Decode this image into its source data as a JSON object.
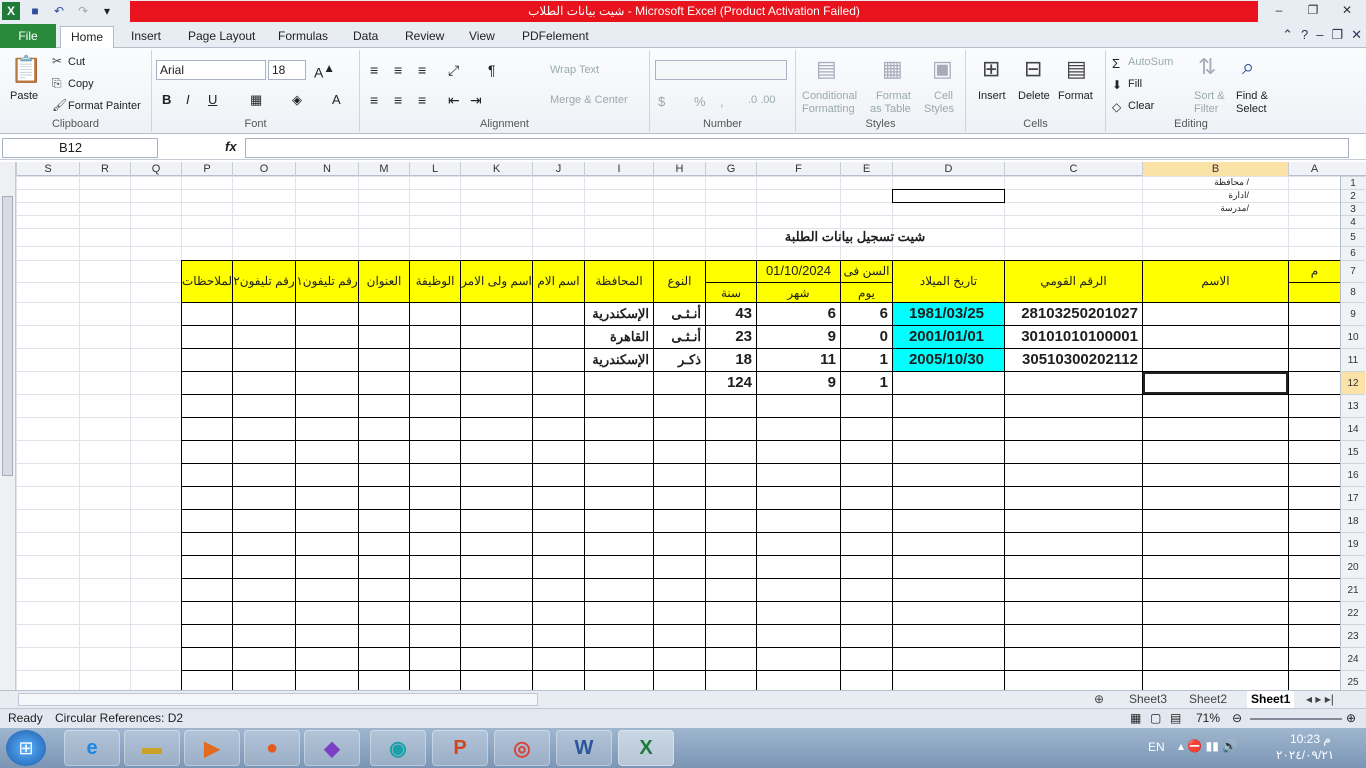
{
  "window": {
    "title": "شيت بيانات الطلاب  -  Microsoft Excel (Product Activation Failed)"
  },
  "tabs": [
    "File",
    "Home",
    "Insert",
    "Page Layout",
    "Formulas",
    "Data",
    "Review",
    "View",
    "PDFelement"
  ],
  "ribbon": {
    "clipboard": {
      "paste": "Paste",
      "cut": "Cut",
      "copy": "Copy",
      "format_painter": "Format Painter",
      "label": "Clipboard"
    },
    "font": {
      "name": "Arial",
      "size": "18",
      "label": "Font"
    },
    "alignment": {
      "wrap": "Wrap Text",
      "merge": "Merge & Center",
      "label": "Alignment"
    },
    "number": {
      "pct": "%",
      "comma": ",",
      "label": "Number"
    },
    "styles": {
      "cond1": "Conditional",
      "cond2": "Formatting",
      "fmt1": "Format",
      "fmt2": "as Table",
      "cell1": "Cell",
      "cell2": "Styles",
      "label": "Styles"
    },
    "cells": {
      "insert": "Insert",
      "delete": "Delete",
      "format": "Format",
      "label": "Cells"
    },
    "editing": {
      "autosum": "AutoSum",
      "fill": "Fill",
      "clear": "Clear",
      "sort1": "Sort &",
      "sort2": "Filter",
      "find1": "Find &",
      "find2": "Select",
      "label": "Editing"
    }
  },
  "formula_bar": {
    "name_box": "B12",
    "fx": "fx",
    "value": ""
  },
  "columns": [
    "S",
    "R",
    "Q",
    "P",
    "O",
    "N",
    "M",
    "L",
    "K",
    "J",
    "I",
    "H",
    "G",
    "F",
    "E",
    "D",
    "C",
    "B",
    "A"
  ],
  "rows": [
    "1",
    "2",
    "3",
    "4",
    "5",
    "6",
    "7",
    "8",
    "9",
    "10",
    "11",
    "12",
    "13",
    "14",
    "15",
    "16",
    "17",
    "18",
    "19",
    "20",
    "21",
    "22",
    "23",
    "24",
    "25"
  ],
  "sheet": {
    "b1": "محافظة /",
    "b2": "ادارة/",
    "b3": "مدرسة/",
    "title": "شيت تسجيل بيانات الطلبة",
    "headers": {
      "m": "م",
      "name": "الاسم",
      "national_id": "الرقم القومي",
      "dob": "تاريخ الميلاد",
      "age_at": "السن فى",
      "age_date": "01/10/2024",
      "day": "يوم",
      "month": "شهر",
      "year": "سنة",
      "gender": "النوع",
      "governorate": "المحافظة",
      "mother": "اسم الام",
      "guardian": "اسم ولى الامر",
      "job": "الوظيفة",
      "address": "العنوان",
      "phone1": "رقم تليفون١",
      "phone2": "رقم تليفون٢",
      "notes": "الملاحظات"
    },
    "records": [
      {
        "national_id": "28103250201027",
        "dob": "1981/03/25",
        "day": "6",
        "month": "6",
        "year": "43",
        "gender": "أنـثـى",
        "governorate": "الإسكندرية"
      },
      {
        "national_id": "30101010100001",
        "dob": "2001/01/01",
        "day": "0",
        "month": "9",
        "year": "23",
        "gender": "أنـثـى",
        "governorate": "القاهرة"
      },
      {
        "national_id": "30510300202112",
        "dob": "2005/10/30",
        "day": "1",
        "month": "11",
        "year": "18",
        "gender": "ذكـر",
        "governorate": "الإسكندرية"
      }
    ],
    "row12": {
      "day": "1",
      "month": "9",
      "year": "124"
    }
  },
  "sheet_tabs": [
    "Sheet3",
    "Sheet2",
    "Sheet1"
  ],
  "status": {
    "ready": "Ready",
    "circular": "Circular References: D2",
    "zoom": "71%"
  },
  "taskbar": {
    "lang": "EN",
    "time": "10:23 م",
    "date": "٢٠٢٤/٠٩/٢١"
  }
}
